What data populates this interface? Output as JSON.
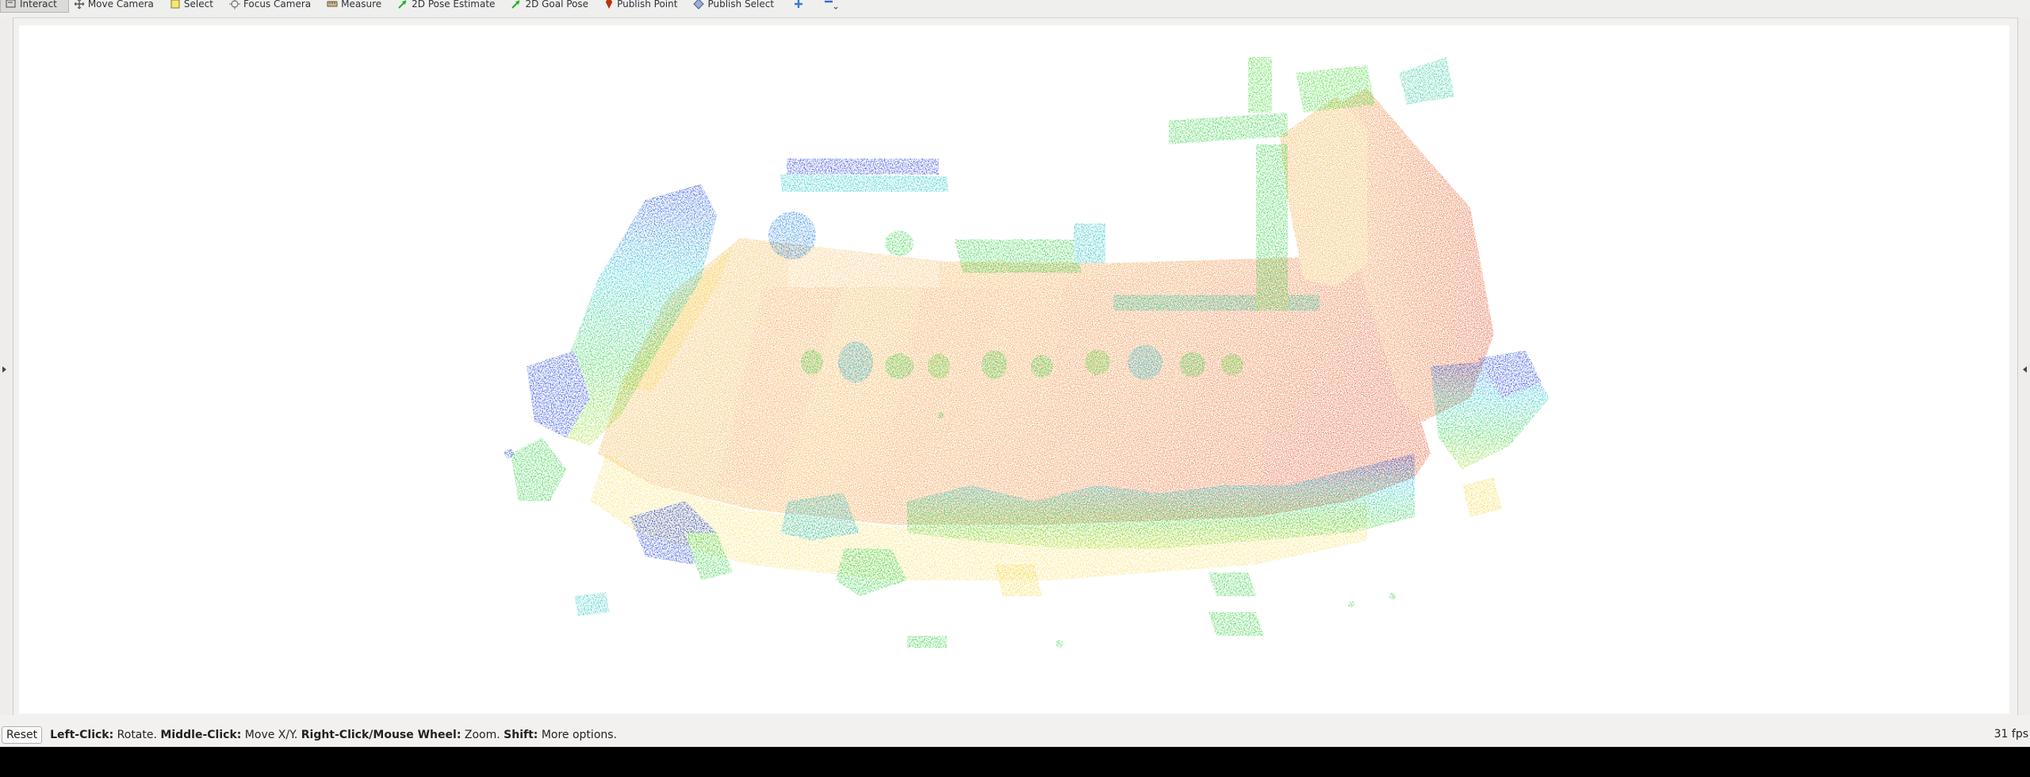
{
  "toolbar": {
    "tools": [
      {
        "label": "Interact",
        "icon": "interact-icon",
        "active": true
      },
      {
        "label": "Move Camera",
        "icon": "move-camera-icon"
      },
      {
        "label": "Select",
        "icon": "select-icon"
      },
      {
        "label": "Focus Camera",
        "icon": "focus-camera-icon"
      },
      {
        "label": "Measure",
        "icon": "measure-icon"
      },
      {
        "label": "2D Pose Estimate",
        "icon": "pose-estimate-arrow-icon"
      },
      {
        "label": "2D Goal Pose",
        "icon": "goal-pose-arrow-icon"
      },
      {
        "label": "Publish Point",
        "icon": "map-pin-icon"
      },
      {
        "label": "Publish Select",
        "icon": "publish-select-icon"
      }
    ],
    "extra_icons": [
      "plus-icon",
      "minus-dropdown-icon"
    ]
  },
  "status": {
    "reset_label": "Reset",
    "help": [
      {
        "key": "Left-Click:",
        "text": " Rotate. "
      },
      {
        "key": "Middle-Click:",
        "text": " Move X/Y. "
      },
      {
        "key": "Right-Click/Mouse Wheel:",
        "text": " Zoom. "
      },
      {
        "key": "Shift:",
        "text": " More options."
      }
    ],
    "fps": "31 fps"
  },
  "viewport": {
    "content": "point-cloud",
    "colors": {
      "ground_orange": "#f0a030",
      "ground_red": "#e85020",
      "ground_yellow": "#f5d840",
      "vegetation_green": "#30d040",
      "vegetation_cyan": "#20d0c0",
      "vegetation_blue": "#2040e0",
      "vegetation_violet": "#6020c0",
      "background": "#ffffff"
    }
  }
}
